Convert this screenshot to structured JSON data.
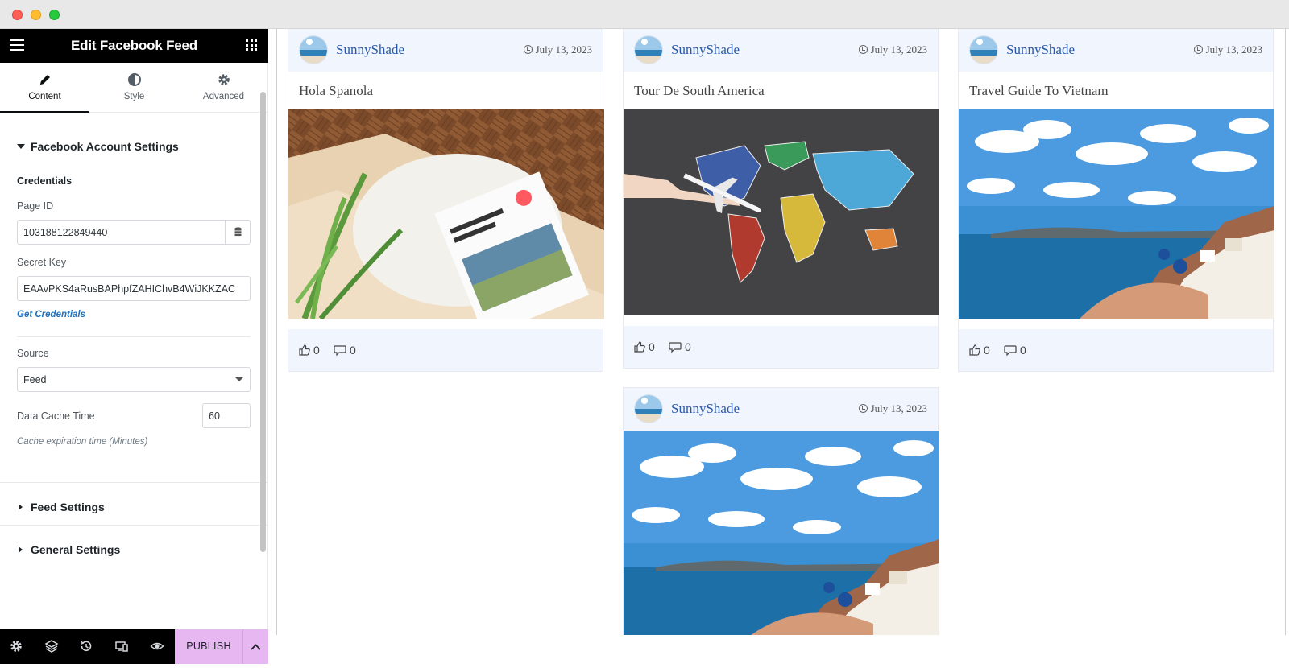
{
  "editor": {
    "title": "Edit Facebook Feed",
    "tabs": [
      {
        "label": "Content",
        "icon": "pencil-icon",
        "active": true
      },
      {
        "label": "Style",
        "icon": "half-circle-icon",
        "active": false
      },
      {
        "label": "Advanced",
        "icon": "gear-icon",
        "active": false
      }
    ],
    "account_section": "Facebook Account Settings",
    "credentials_label": "Credentials",
    "page_id_label": "Page ID",
    "page_id_value": "103188122849440",
    "secret_key_label": "Secret Key",
    "secret_key_value": "EAAvPKS4aRusBAPhpfZAHIChvB4WiJKKZAC",
    "get_credentials": "Get Credentials",
    "source_label": "Source",
    "source_value": "Feed",
    "cache_label": "Data Cache Time",
    "cache_value": "60",
    "cache_hint": "Cache expiration time (Minutes)",
    "feed_settings": "Feed Settings",
    "general_settings": "General Settings",
    "publish_label": "PUBLISH"
  },
  "posts": [
    {
      "author": "SunnyShade",
      "date": "July 13, 2023",
      "title": "Hola Spanola",
      "image": "guidebook-photo",
      "likes": "0",
      "comments": "0"
    },
    {
      "author": "SunnyShade",
      "date": "July 13, 2023",
      "title": "Tour De South America",
      "image": "world-map-chalkboard-photo",
      "likes": "0",
      "comments": "0"
    },
    {
      "author": "SunnyShade",
      "date": "July 13, 2023",
      "title": "Travel Guide To Vietnam",
      "image": "santorini-coast-photo",
      "likes": "0",
      "comments": "0"
    },
    {
      "author": "SunnyShade",
      "date": "July 13, 2023",
      "title": "",
      "image": "santorini-coast-photo",
      "likes": "",
      "comments": ""
    }
  ],
  "colors": {
    "accent_publish": "#e7b7f1",
    "author_link": "#2a5aa8",
    "card_band": "#f1f5fd",
    "header_bg": "#000000"
  }
}
